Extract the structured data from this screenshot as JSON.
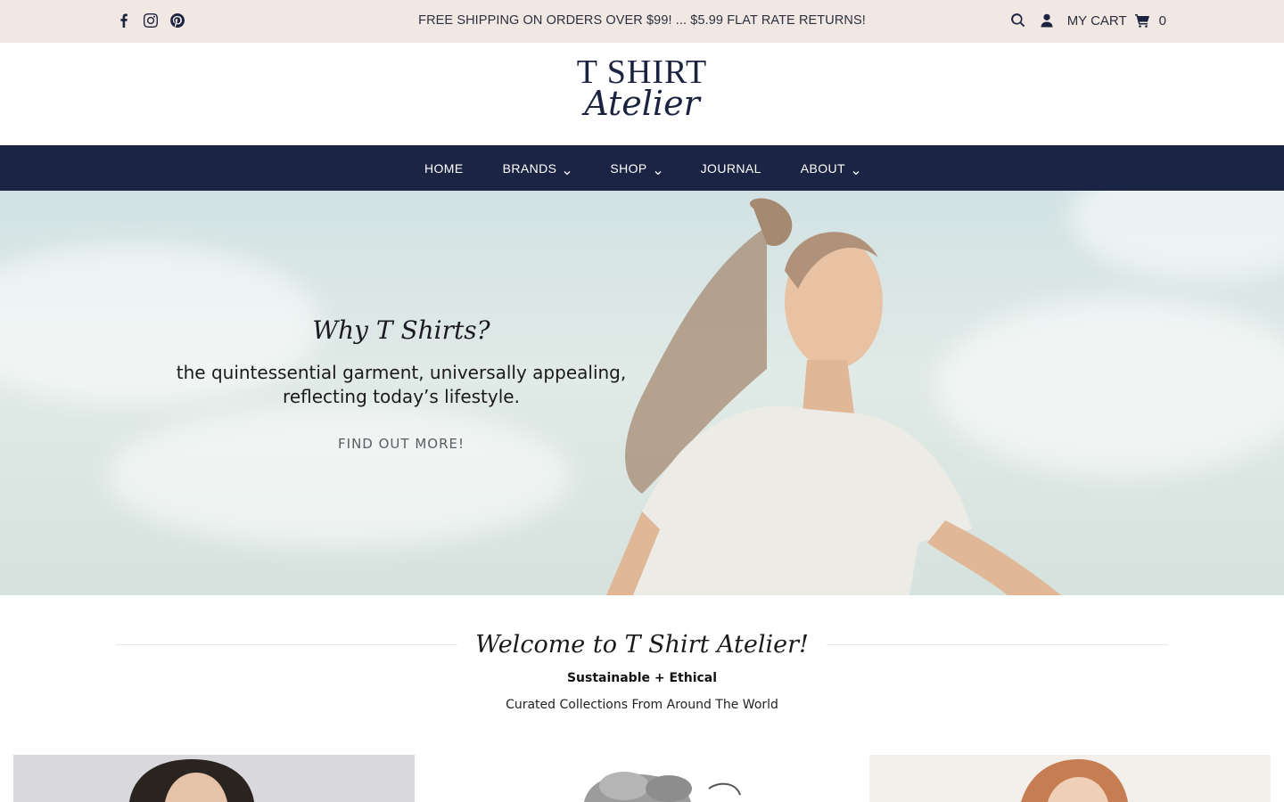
{
  "topbar": {
    "social": [
      {
        "icon": "facebook-icon"
      },
      {
        "icon": "instagram-icon"
      },
      {
        "icon": "pinterest-icon"
      }
    ],
    "announcement": "FREE SHIPPING ON ORDERS OVER $99! ... $5.99 FLAT RATE RETURNS!",
    "cart_label": "MY CART",
    "cart_count": "0"
  },
  "logo": {
    "line1": "T SHIRT",
    "line2": "Atelier"
  },
  "nav": {
    "items": [
      {
        "label": "HOME",
        "dropdown": false
      },
      {
        "label": "BRANDS",
        "dropdown": true
      },
      {
        "label": "SHOP",
        "dropdown": true
      },
      {
        "label": "JOURNAL",
        "dropdown": false
      },
      {
        "label": "ABOUT",
        "dropdown": true
      }
    ]
  },
  "hero": {
    "title": "Why T Shirts?",
    "subtitle_line1": "the quintessential garment, universally appealing,",
    "subtitle_line2": "reflecting today’s lifestyle.",
    "link": "FIND OUT MORE!"
  },
  "welcome": {
    "title": "Welcome to T Shirt Atelier!",
    "bold": "Sustainable + Ethical",
    "sub": "Curated Collections From Around The World"
  },
  "colors": {
    "topbar_bg": "#f1e8e3",
    "nav_bg": "#1c2443",
    "brand_navy": "#1c2340"
  }
}
